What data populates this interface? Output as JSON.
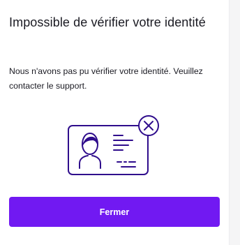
{
  "dialog": {
    "title": "Impossible de vérifier votre identité",
    "message": "Nous n'avons pas pu vérifier votre identité. Veuillez contacter le support.",
    "close_label": "Fermer"
  },
  "illustration": {
    "icon": "id-card-error-icon",
    "stroke_color": "#2f0d8c"
  },
  "colors": {
    "primary": "#7119f2",
    "text": "#1a1a22"
  }
}
